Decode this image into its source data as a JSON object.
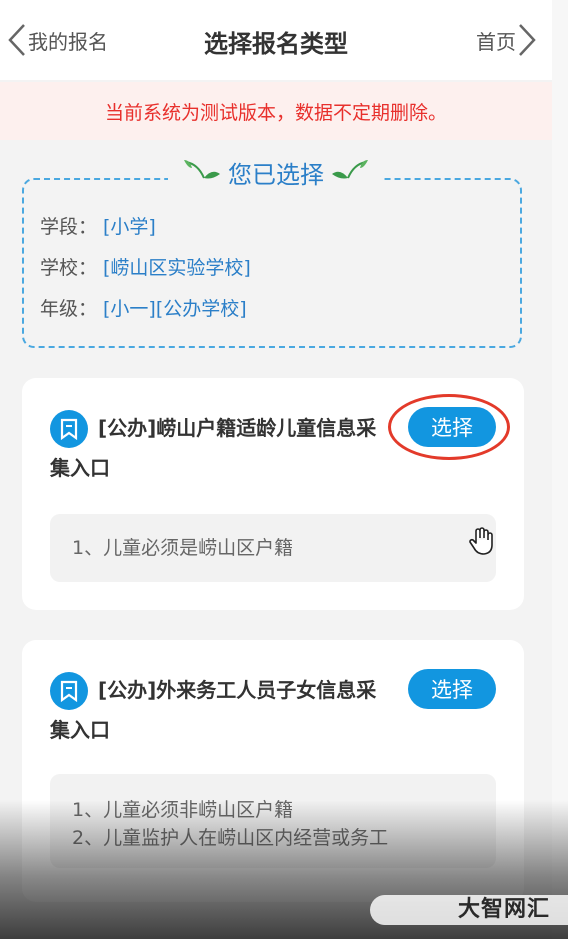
{
  "header": {
    "back_label": "我的报名",
    "title": "选择报名类型",
    "home_label": "首页"
  },
  "notice": "当前系统为测试版本，数据不定期删除。",
  "selected": {
    "heading": "您已选择",
    "rows": [
      {
        "label": "学段：",
        "value": "[小学]"
      },
      {
        "label": "学校：",
        "value": "[崂山区实验学校]"
      },
      {
        "label": "年级：",
        "value": "[小一][公办学校]"
      }
    ]
  },
  "cards": [
    {
      "title_line1": "[公办]崂山户籍适龄儿童信息采",
      "title_line2": "集入口",
      "button": "选择",
      "requirements": [
        "1、儿童必须是崂山区户籍"
      ]
    },
    {
      "title_line1": "[公办]外来务工人员子女信息采",
      "title_line2": "集入口",
      "button": "选择",
      "requirements": [
        "1、儿童必须非崂山区户籍",
        "2、儿童监护人在崂山区内经营或务工"
      ]
    }
  ],
  "watermark": "大智网汇",
  "colors": {
    "accent": "#1296e0",
    "notice_text": "#e8302c",
    "highlight_circle": "#e33a2a"
  }
}
